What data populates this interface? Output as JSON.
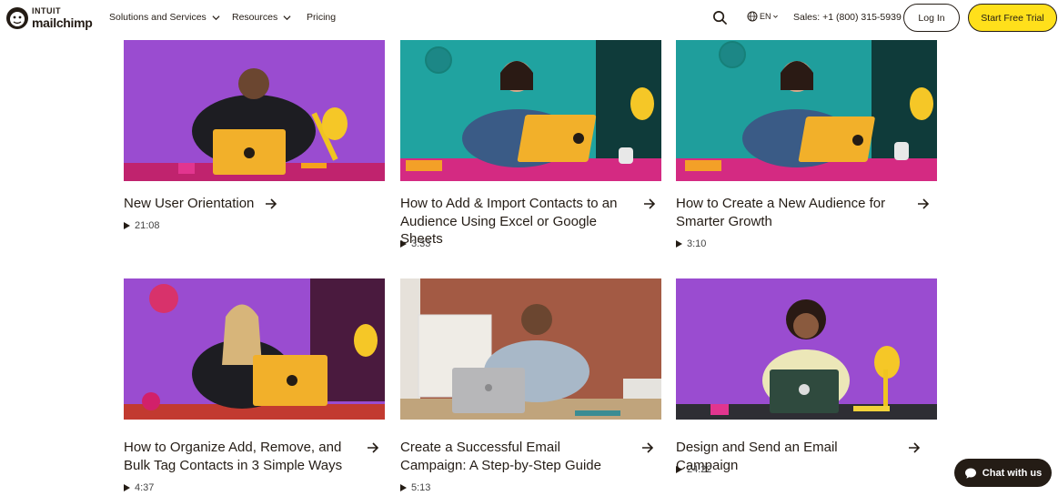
{
  "brand": {
    "intuit": "INTUIT",
    "name": "mailchimp"
  },
  "nav": {
    "solutions": "Solutions and Services",
    "resources": "Resources",
    "pricing": "Pricing",
    "lang": "EN",
    "sales": "Sales: +1 (800) 315-5939",
    "login": "Log In",
    "trial": "Start Free Trial"
  },
  "videos": [
    {
      "title": "New User Orientation",
      "duration": "21:08"
    },
    {
      "title": "How to Add & Import Contacts to an Audience Using Excel or Google Sheets",
      "duration": "3:33"
    },
    {
      "title": "How to Create a New Audience for Smarter Growth",
      "duration": "3:10"
    },
    {
      "title": "How to Organize Add, Remove, and Bulk Tag Contacts in 3 Simple Ways",
      "duration": "4:37"
    },
    {
      "title": "Create a Successful Email Campaign: A Step-by-Step Guide",
      "duration": "5:13"
    },
    {
      "title": "Design and Send an Email Campaign",
      "duration": "24:22"
    }
  ],
  "chat": {
    "label": "Chat with us"
  },
  "colors": {
    "accent": "#ffe01b",
    "text": "#241c15",
    "purple": "#8e45c9",
    "teal": "#1f9e9c",
    "magenta": "#e0288a"
  }
}
